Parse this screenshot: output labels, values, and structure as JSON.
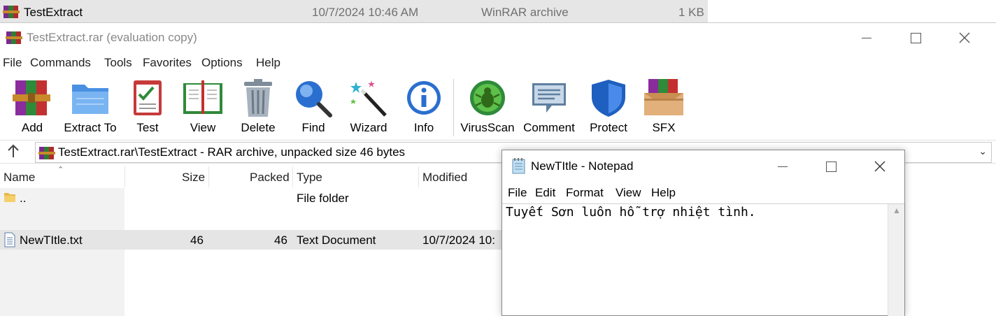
{
  "explorer_row": {
    "name": "TestExtract",
    "date": "10/7/2024 10:46 AM",
    "type": "WinRAR archive",
    "size": "1 KB"
  },
  "winrar": {
    "title": "TestExtract.rar (evaluation copy)",
    "menu": [
      "File",
      "Commands",
      "Tools",
      "Favorites",
      "Options",
      "Help"
    ],
    "toolbar": [
      {
        "label": "Add",
        "icon": "add-icon"
      },
      {
        "label": "Extract To",
        "icon": "extract-to-icon"
      },
      {
        "label": "Test",
        "icon": "test-icon"
      },
      {
        "label": "View",
        "icon": "view-icon"
      },
      {
        "label": "Delete",
        "icon": "delete-icon"
      },
      {
        "label": "Find",
        "icon": "find-icon"
      },
      {
        "label": "Wizard",
        "icon": "wizard-icon"
      },
      {
        "label": "Info",
        "icon": "info-icon"
      },
      {
        "label": "VirusScan",
        "icon": "virusscan-icon"
      },
      {
        "label": "Comment",
        "icon": "comment-icon"
      },
      {
        "label": "Protect",
        "icon": "protect-icon"
      },
      {
        "label": "SFX",
        "icon": "sfx-icon"
      }
    ],
    "address": "TestExtract.rar\\TestExtract - RAR archive, unpacked size 46 bytes",
    "columns": {
      "name": "Name",
      "size": "Size",
      "packed": "Packed",
      "type": "Type",
      "modified": "Modified"
    },
    "rows": [
      {
        "name": "..",
        "size": "",
        "packed": "",
        "type": "File folder",
        "modified": ""
      },
      {
        "name": "NewTItle.txt",
        "size": "46",
        "packed": "46",
        "type": "Text Document",
        "modified": "10/7/2024 10:"
      }
    ]
  },
  "notepad": {
    "title": "NewTItle - Notepad",
    "menu": [
      "File",
      "Edit",
      "Format",
      "View",
      "Help"
    ],
    "content": "Tuyết Sơn luôn hỗ trợ nhiệt tình."
  }
}
